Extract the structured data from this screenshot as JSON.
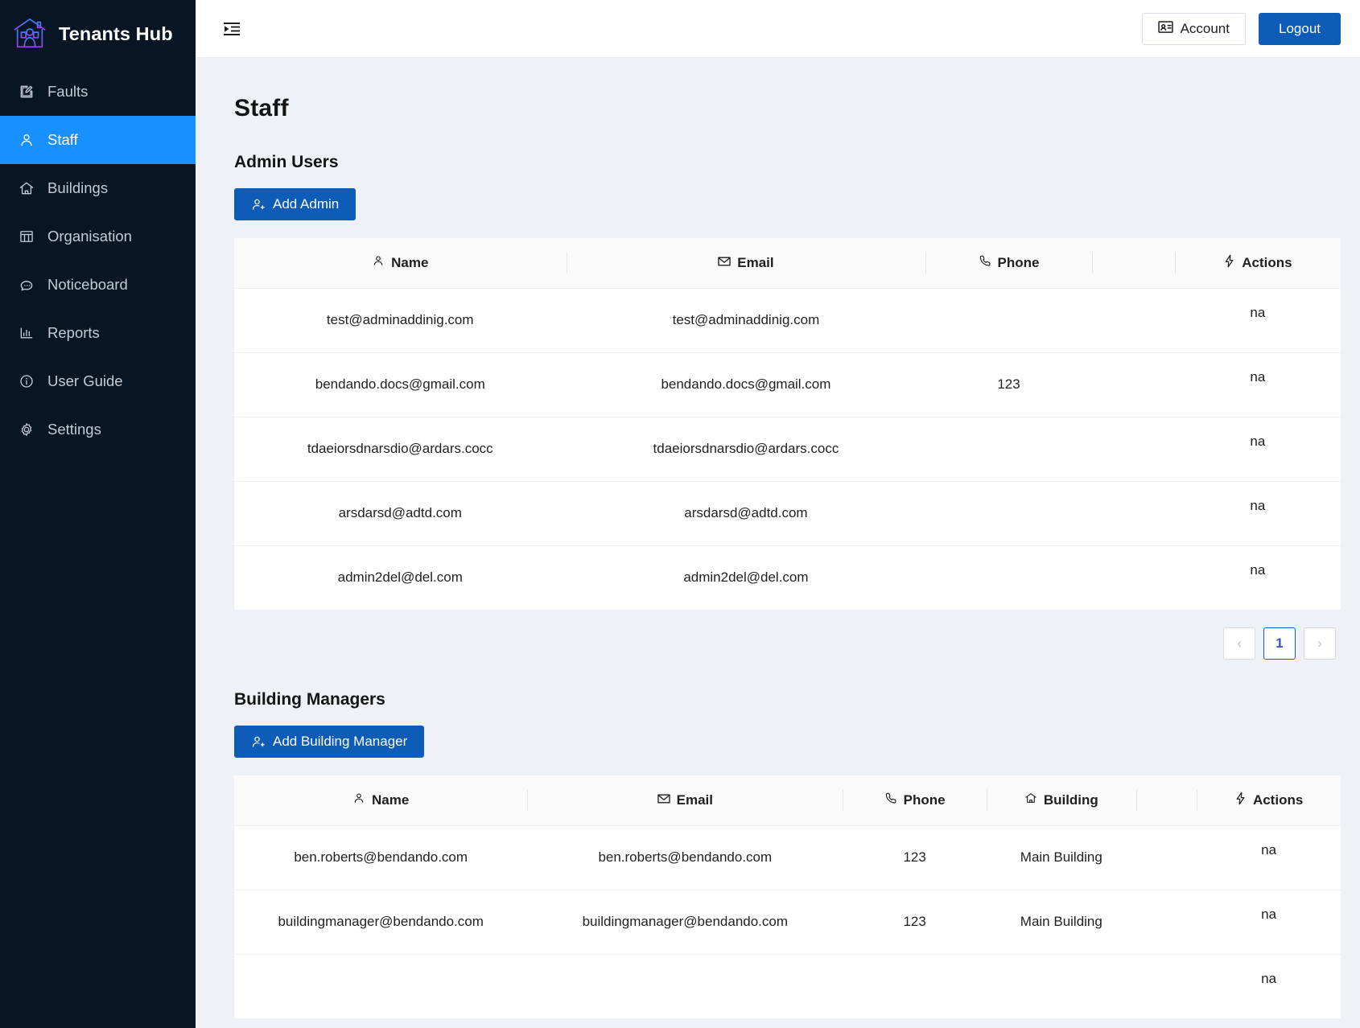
{
  "sidebar": {
    "brand": "Tenants Hub",
    "logo_icon": "house-person-icon",
    "items": [
      {
        "label": "Faults",
        "icon": "edit-square-icon",
        "active": false
      },
      {
        "label": "Staff",
        "icon": "user-icon",
        "active": true
      },
      {
        "label": "Buildings",
        "icon": "home-icon",
        "active": false
      },
      {
        "label": "Organisation",
        "icon": "layout-icon",
        "active": false
      },
      {
        "label": "Noticeboard",
        "icon": "message-icon",
        "active": false
      },
      {
        "label": "Reports",
        "icon": "bar-chart-icon",
        "active": false
      },
      {
        "label": "User Guide",
        "icon": "info-circle-icon",
        "active": false
      },
      {
        "label": "Settings",
        "icon": "gear-icon",
        "active": false
      }
    ]
  },
  "topbar": {
    "collapse_icon": "menu-unfold-icon",
    "account_label": "Account",
    "account_icon": "id-card-icon",
    "logout_label": "Logout"
  },
  "page": {
    "title": "Staff"
  },
  "admin_section": {
    "heading": "Admin Users",
    "add_button": "Add Admin",
    "add_button_icon": "user-add-icon",
    "columns": [
      {
        "label": "Name",
        "icon": "user-icon"
      },
      {
        "label": "Email",
        "icon": "mail-icon"
      },
      {
        "label": "Phone",
        "icon": "phone-icon"
      },
      {
        "label": "",
        "icon": ""
      },
      {
        "label": "Actions",
        "icon": "thunderbolt-icon"
      }
    ],
    "rows": [
      {
        "name": "test@adminaddinig.com",
        "email": "test@adminaddinig.com",
        "phone": "",
        "extra": "",
        "actions": "na"
      },
      {
        "name": "bendando.docs@gmail.com",
        "email": "bendando.docs@gmail.com",
        "phone": "123",
        "extra": "",
        "actions": "na"
      },
      {
        "name": "tdaeiorsdnarsdio@ardars.cocc",
        "email": "tdaeiorsdnarsdio@ardars.cocc",
        "phone": "",
        "extra": "",
        "actions": "na"
      },
      {
        "name": "arsdarsd@adtd.com",
        "email": "arsdarsd@adtd.com",
        "phone": "",
        "extra": "",
        "actions": "na"
      },
      {
        "name": "admin2del@del.com",
        "email": "admin2del@del.com",
        "phone": "",
        "extra": "",
        "actions": "na"
      }
    ],
    "pagination": {
      "prev": "‹",
      "current": "1",
      "next": "›"
    }
  },
  "manager_section": {
    "heading": "Building Managers",
    "add_button": "Add Building Manager",
    "add_button_icon": "user-add-icon",
    "columns": [
      {
        "label": "Name",
        "icon": "user-icon"
      },
      {
        "label": "Email",
        "icon": "mail-icon"
      },
      {
        "label": "Phone",
        "icon": "phone-icon"
      },
      {
        "label": "Building",
        "icon": "home-icon"
      },
      {
        "label": "",
        "icon": ""
      },
      {
        "label": "Actions",
        "icon": "thunderbolt-icon"
      }
    ],
    "rows": [
      {
        "name": "ben.roberts@bendando.com",
        "email": "ben.roberts@bendando.com",
        "phone": "123",
        "building": "Main Building",
        "extra": "",
        "actions": "na"
      },
      {
        "name": "buildingmanager@bendando.com",
        "email": "buildingmanager@bendando.com",
        "phone": "123",
        "building": "Main Building",
        "extra": "",
        "actions": "na"
      },
      {
        "name": "",
        "email": "",
        "phone": "",
        "building": "",
        "extra": "",
        "actions": "na"
      }
    ]
  },
  "colors": {
    "sidebar_bg": "#081524",
    "sidebar_active": "#1890ff",
    "primary": "#0c5cb8",
    "content_bg": "#eef1f6",
    "card_bg": "#ffffff"
  }
}
